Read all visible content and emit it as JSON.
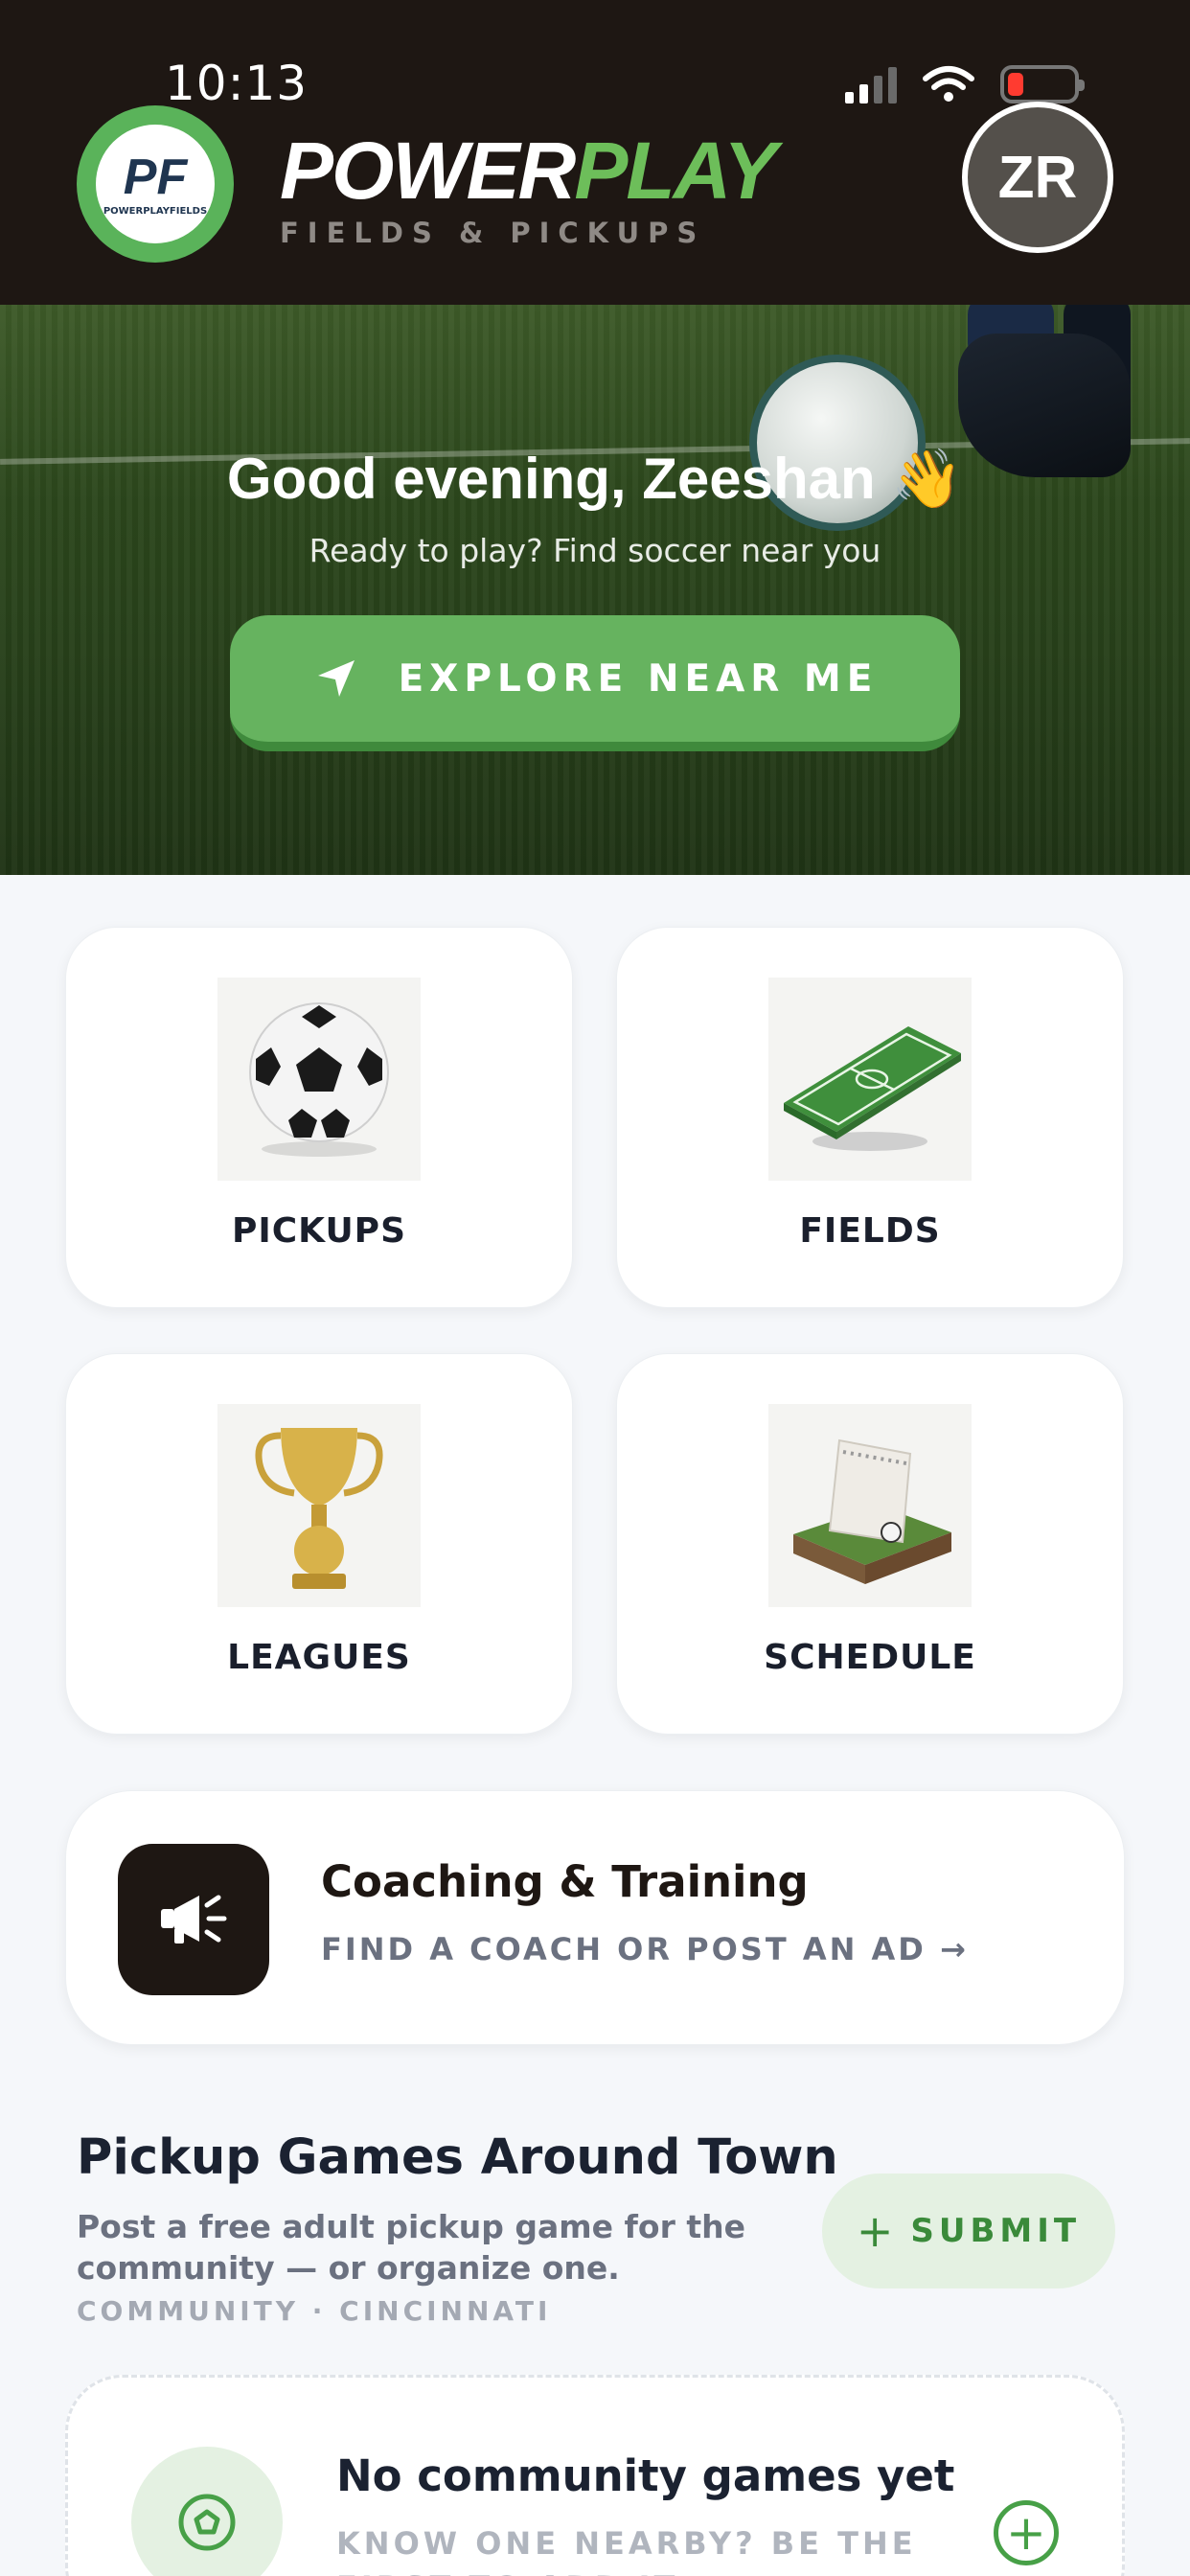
{
  "status_bar": {
    "time": "10:13"
  },
  "header": {
    "logo_monogram": "PF",
    "logo_text": "POWERPLAYFIELDS",
    "brand_part1": "POWER",
    "brand_part2": "PLAY",
    "brand_subtitle": "FIELDS & PICKUPS",
    "avatar_initials": "ZR"
  },
  "hero": {
    "greeting": "Good evening, Zeeshan 👋",
    "subtitle": "Ready to play? Find soccer near you",
    "explore_label": "EXPLORE NEAR ME"
  },
  "tiles": [
    {
      "label": "PICKUPS",
      "icon": "soccer-ball-icon"
    },
    {
      "label": "FIELDS",
      "icon": "soccer-field-icon"
    },
    {
      "label": "LEAGUES",
      "icon": "trophy-icon"
    },
    {
      "label": "SCHEDULE",
      "icon": "calendar-icon"
    }
  ],
  "coaching": {
    "title": "Coaching & Training",
    "subtitle": "FIND A COACH OR POST AN AD →",
    "icon": "megaphone-icon"
  },
  "pickup_section": {
    "title": "Pickup Games Around Town",
    "description": "Post a free adult pickup game for the community — or organize one.",
    "meta": "COMMUNITY · CINCINNATI",
    "submit_label": "SUBMIT",
    "submit_icon": "+"
  },
  "empty_state": {
    "title": "No community games yet",
    "subtitle": "KNOW ONE NEARBY? BE THE FIRST TO ADD IT →",
    "add_icon": "+"
  },
  "colors": {
    "header_bg": "#1e1713",
    "accent_green": "#66b35f",
    "brand_green": "#6dbe5a",
    "page_bg": "#f5f7fa"
  }
}
